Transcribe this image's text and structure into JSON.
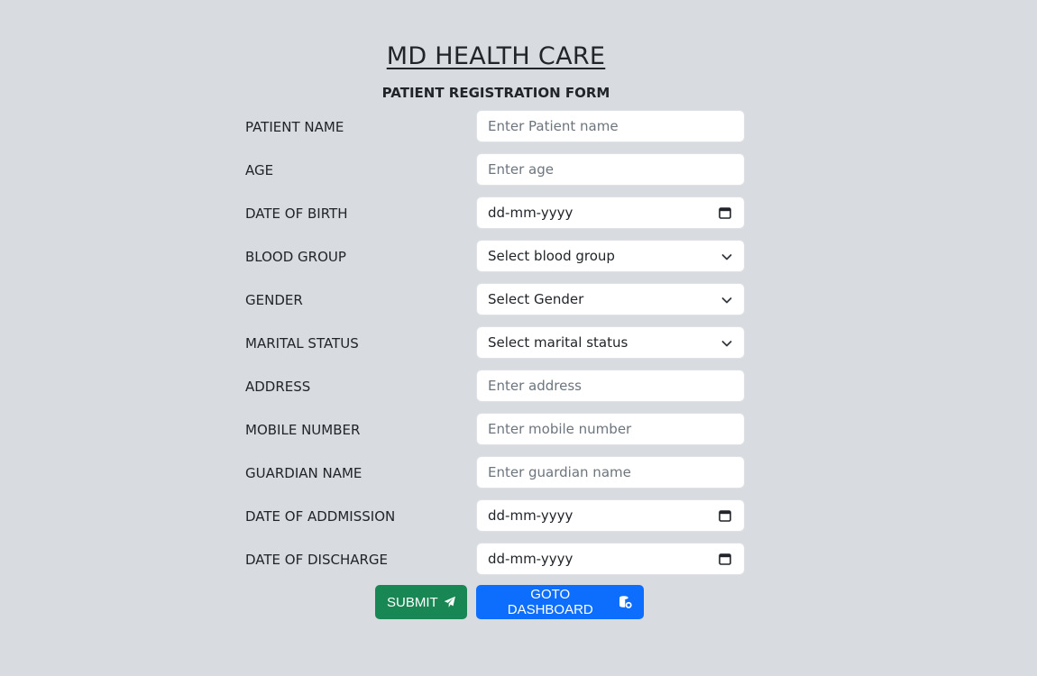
{
  "header": {
    "title": "MD HEALTH CARE",
    "subtitle": "PATIENT REGISTRATION FORM"
  },
  "form": {
    "patient_name": {
      "label": "PATIENT NAME",
      "placeholder": "Enter Patient name"
    },
    "age": {
      "label": "AGE",
      "placeholder": "Enter age"
    },
    "date_of_birth": {
      "label": "DATE OF BIRTH",
      "value": "dd-mm-yyyy"
    },
    "blood_group": {
      "label": "BLOOD GROUP",
      "value": "Select blood group"
    },
    "gender": {
      "label": "GENDER",
      "value": "Select Gender"
    },
    "marital_status": {
      "label": "MARITAL STATUS",
      "value": "Select marital status"
    },
    "address": {
      "label": "ADDRESS",
      "placeholder": "Enter address"
    },
    "mobile_number": {
      "label": "MOBILE NUMBER",
      "placeholder": "Enter mobile number"
    },
    "guardian_name": {
      "label": "GUARDIAN NAME",
      "placeholder": "Enter guardian name"
    },
    "date_of_admission": {
      "label": "DATE OF ADDMISSION",
      "value": "dd-mm-yyyy"
    },
    "date_of_discharge": {
      "label": "DATE OF DISCHARGE",
      "value": "dd-mm-yyyy"
    }
  },
  "buttons": {
    "submit_label": "SUBMIT",
    "submit_icon": "paper-plane-icon",
    "dashboard_label": "GOTO DASHBOARD",
    "dashboard_icon": "database-icon"
  },
  "colors": {
    "background": "#d8dbdf",
    "submit": "#198754",
    "dashboard": "#0d6efd"
  }
}
